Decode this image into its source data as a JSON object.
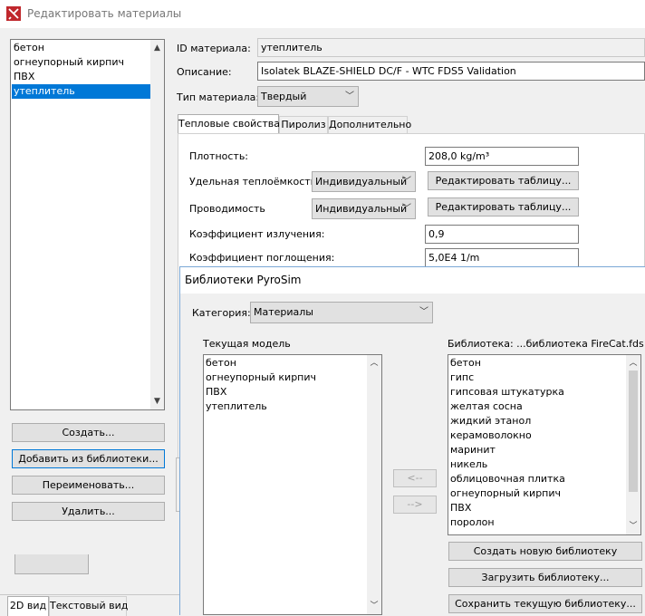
{
  "main_window": {
    "title": "Редактировать материалы",
    "materials": [
      "бетон",
      "огнеупорный кирпич",
      "ПВХ",
      "утеплитель"
    ],
    "selected_index": 3,
    "buttons": {
      "create": "Создать...",
      "add_from_library": "Добавить из библиотеки...",
      "rename": "Переименовать...",
      "delete": "Удалить..."
    },
    "fields": {
      "id_label": "ID материала:",
      "id_value": "утеплитель",
      "description_label": "Описание:",
      "description_value": "Isolatek BLAZE-SHIELD DC/F - WTC FDS5 Validation",
      "type_label": "Тип материала:",
      "type_value": "Твердый"
    },
    "tabs": [
      "Тепловые свойства",
      "Пиролиз",
      "Дополнительно"
    ],
    "thermal": {
      "density_label": "Плотность:",
      "density_value": "208,0 kg/m³",
      "specific_heat_label": "Удельная теплоёмкость",
      "specific_heat_mode": "Индивидуальный",
      "conductivity_label": "Проводимость",
      "conductivity_mode": "Индивидуальный",
      "edit_table": "Редактировать таблицу...",
      "emissivity_label": "Коэффициент излучения:",
      "emissivity_value": "0,9",
      "absorption_label": "Коэффициент поглощения:",
      "absorption_value": "5,0E4 1/m"
    }
  },
  "bottom_tabs": [
    "2D вид",
    "Текстовый вид"
  ],
  "library_dialog": {
    "title": "Библиотеки PyroSim",
    "category_label": "Категория:",
    "category_value": "Материалы",
    "current_model_label": "Текущая модель",
    "current_model_items": [
      "бетон",
      "огнеупорный кирпич",
      "ПВХ",
      "утеплитель"
    ],
    "library_label": "Библиотека: ...библиотека FireCat.fds",
    "library_items": [
      "бетон",
      "гипс",
      "гипсовая штукатурка",
      "желтая сосна",
      "жидкий этанол",
      "керамоволокно",
      "маринит",
      "никель",
      "облицовочная плитка",
      "огнеупорный кирпич",
      "ПВХ",
      "поролон"
    ],
    "move_left": "<--",
    "move_right": "-->",
    "buttons": {
      "create_library": "Создать новую библиотеку",
      "load_library": "Загрузить библиотеку...",
      "save_library": "Сохранить текущую библиотеку..."
    }
  },
  "icons": {
    "app": "pyrosim-app-icon",
    "chevron": "chevron-down-icon",
    "scroll_up": "scroll-up-arrow-icon",
    "scroll_down": "scroll-down-arrow-icon"
  },
  "colors": {
    "selection": "#0078d7",
    "app_icon": "#c0282d"
  }
}
